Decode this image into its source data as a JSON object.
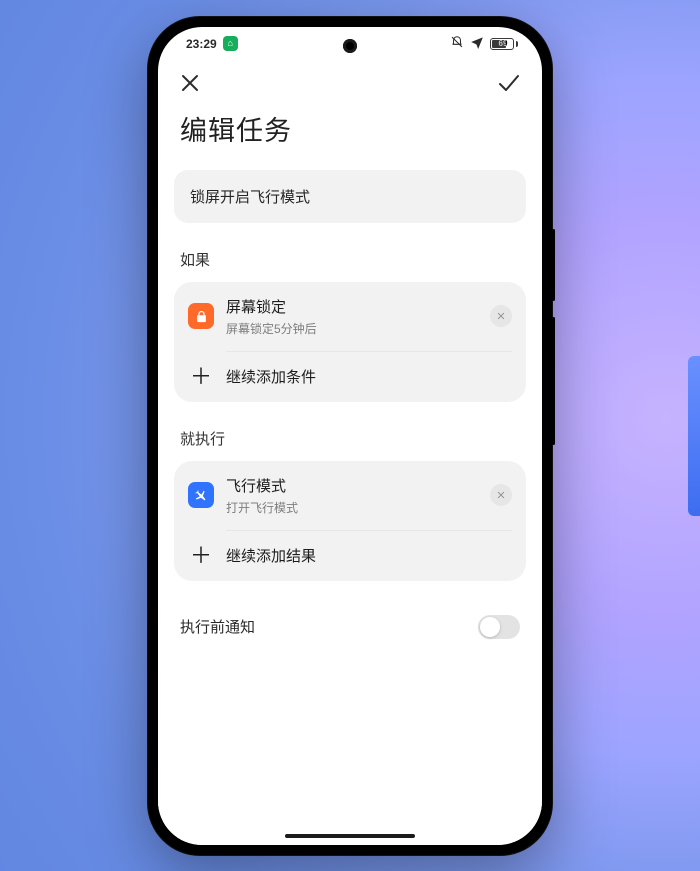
{
  "status": {
    "time": "23:29",
    "battery_percent": "69"
  },
  "page": {
    "title": "编辑任务"
  },
  "task": {
    "name": "锁屏开启飞行模式"
  },
  "sections": {
    "if_label": "如果",
    "then_label": "就执行"
  },
  "conditions": [
    {
      "title": "屏幕锁定",
      "subtitle": "屏幕锁定5分钟后",
      "icon": "lock-icon",
      "icon_color": "orange"
    }
  ],
  "actions_add_label": "继续添加条件",
  "results": [
    {
      "title": "飞行模式",
      "subtitle": "打开飞行模式",
      "icon": "airplane-icon",
      "icon_color": "blue"
    }
  ],
  "results_add_label": "继续添加结果",
  "notify": {
    "label": "执行前通知",
    "enabled": false
  }
}
